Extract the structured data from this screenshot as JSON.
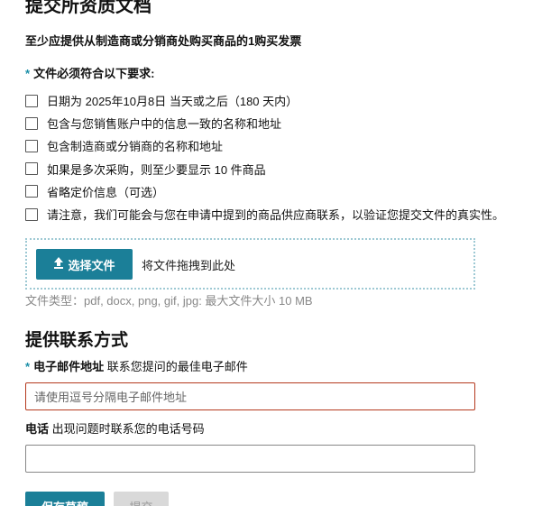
{
  "documents": {
    "title": "提交所资质文档",
    "subtitle": "至少应提供从制造商或分销商处购买商品的1购买发票",
    "requirements_heading": "文件必须符合以下要求:",
    "required_marker": "*",
    "requirements": [
      {
        "label": "日期为 2025年10月8日 当天或之后（180 天内）",
        "checked": false
      },
      {
        "label": "包含与您销售账户中的信息一致的名称和地址",
        "checked": false
      },
      {
        "label": "包含制造商或分销商的名称和地址",
        "checked": false
      },
      {
        "label": "如果是多次采购，则至少要显示 10 件商品",
        "checked": false
      },
      {
        "label": "省略定价信息（可选）",
        "checked": false
      },
      {
        "label": "请注意，我们可能会与您在申请中提到的商品供应商联系，以验证您提交文件的真实性。",
        "checked": false
      }
    ],
    "upload_button": "选择文件",
    "upload_icon": "upload-icon",
    "drag_text": "将文件拖拽到此处",
    "file_hint": "文件类型：pdf, docx, png, gif, jpg: 最大文件大小 10 MB"
  },
  "contact": {
    "heading": "提供联系方式",
    "email_label": "电子邮件地址",
    "email_desc": "联系您提问的最佳电子邮件",
    "email_placeholder": "请使用逗号分隔电子邮件地址",
    "email_value": "",
    "phone_label": "电话",
    "phone_desc": "出现问题时联系您的电话号码",
    "phone_value": ""
  },
  "actions": {
    "save_label": "保存草稿",
    "submit_label": "提交"
  },
  "colors": {
    "accent": "#1b7f98",
    "error_border": "#b5391e",
    "disabled": "#d9d9d9"
  }
}
